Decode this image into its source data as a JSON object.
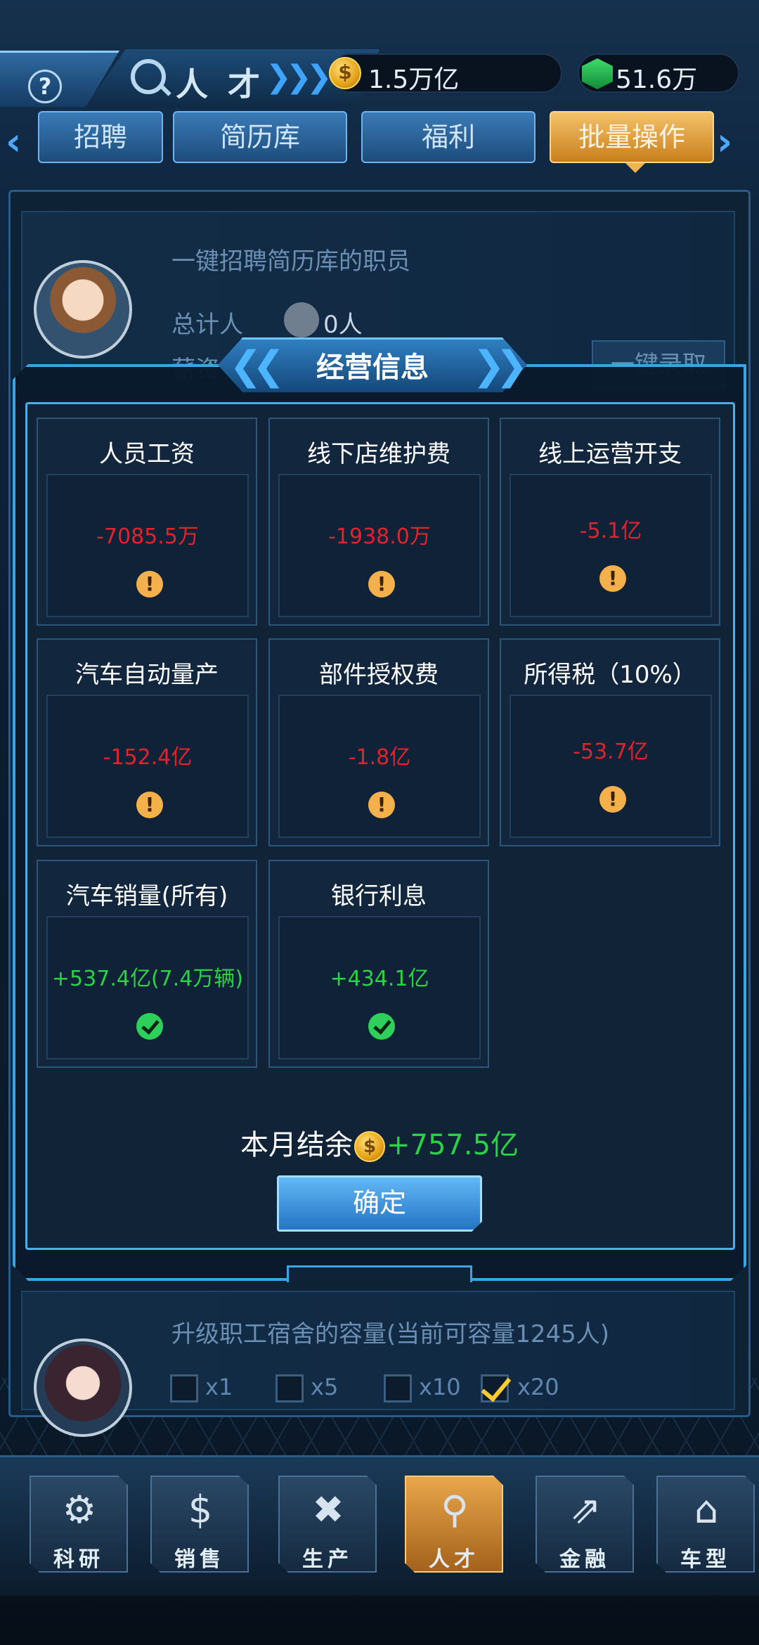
{
  "topbar": {
    "title": "人才",
    "gold": "1.5万亿",
    "gems": "51.6万"
  },
  "tabs": [
    {
      "label": "招聘"
    },
    {
      "label": "简历库"
    },
    {
      "label": "福利"
    },
    {
      "label": "批量操作"
    }
  ],
  "background": {
    "card1_title": "一键招聘简历库的职员",
    "total_label": "总计人",
    "total_value": "0人",
    "salary_label": "薪资",
    "action_label": "一键录取",
    "card2_title": "升级职工宿舍的容量(当前可容量1245人)",
    "options": [
      {
        "label": "x1",
        "checked": false
      },
      {
        "label": "x5",
        "checked": false
      },
      {
        "label": "x10",
        "checked": false
      },
      {
        "label": "x20",
        "checked": true
      }
    ]
  },
  "modal": {
    "title": "经营信息",
    "items": [
      {
        "title": "人员工资",
        "value": "-7085.5万",
        "status": "warning"
      },
      {
        "title": "线下店维护费",
        "value": "-1938.0万",
        "status": "warning"
      },
      {
        "title": "线上运营开支",
        "value": "-5.1亿",
        "status": "warning"
      },
      {
        "title": "汽车自动量产",
        "value": "-152.4亿",
        "status": "warning"
      },
      {
        "title": "部件授权费",
        "value": "-1.8亿",
        "status": "warning"
      },
      {
        "title": "所得税（10%）",
        "value": "-53.7亿",
        "status": "warning"
      },
      {
        "title": "汽车销量(所有)",
        "value": "+537.4亿(7.4万辆)",
        "status": "ok"
      },
      {
        "title": "银行利息",
        "value": "+434.1亿",
        "status": "ok"
      }
    ],
    "balance_label": "本月结余",
    "balance_value": "+757.5亿",
    "confirm_label": "确定"
  },
  "nav": [
    {
      "label": "科研",
      "icon": "research-gear-icon",
      "active": false
    },
    {
      "label": "销售",
      "icon": "sales-money-icon",
      "active": false
    },
    {
      "label": "生产",
      "icon": "production-tools-icon",
      "active": false
    },
    {
      "label": "人才",
      "icon": "talent-search-icon",
      "active": true
    },
    {
      "label": "金融",
      "icon": "finance-chart-icon",
      "active": false
    },
    {
      "label": "车型",
      "icon": "car-garage-icon",
      "active": false
    }
  ],
  "colors": {
    "negative": "#e3222b",
    "positive": "#2ad245",
    "accent": "#3aa5e3",
    "active_tab": "#f2b54e"
  }
}
